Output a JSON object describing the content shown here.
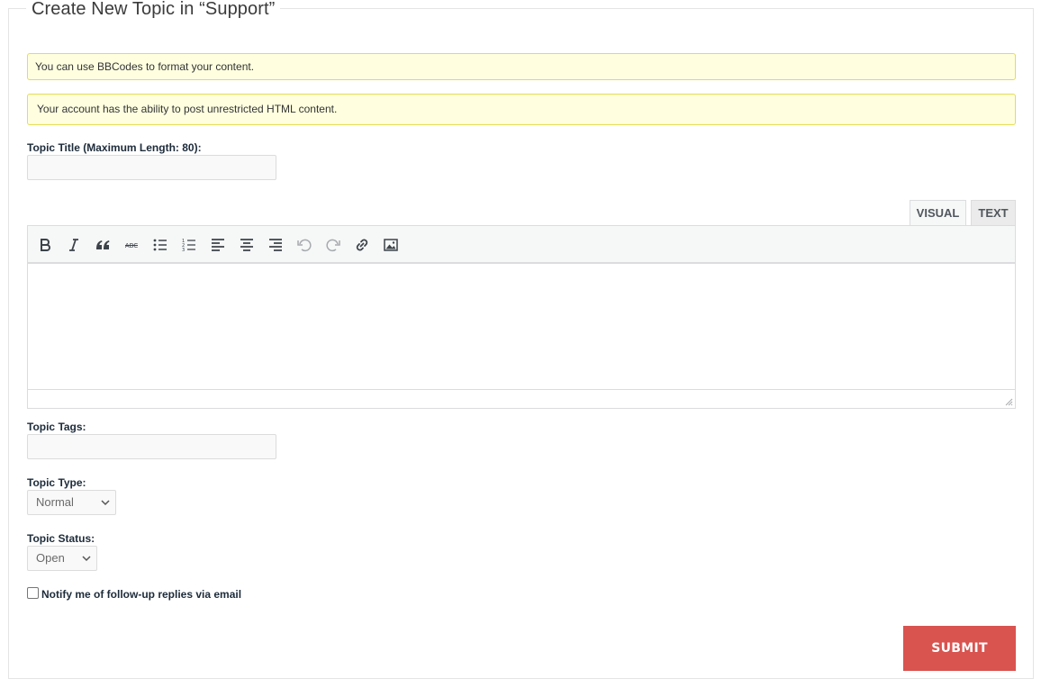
{
  "form": {
    "legend": "Create New Topic in “Support”",
    "notices": [
      "You can use BBCodes to format your content.",
      "Your account has the ability to post unrestricted HTML content."
    ],
    "title_label": "Topic Title (Maximum Length: 80):",
    "title_value": "",
    "editor": {
      "tabs": {
        "visual": "VISUAL",
        "text": "TEXT"
      },
      "active_tab": "visual",
      "toolbar": [
        "bold-icon",
        "italic-icon",
        "blockquote-icon",
        "strikethrough-icon",
        "bulleted-list-icon",
        "numbered-list-icon",
        "align-left-icon",
        "align-center-icon",
        "align-right-icon",
        "undo-icon",
        "redo-icon",
        "link-icon",
        "image-icon"
      ],
      "content": ""
    },
    "tags_label": "Topic Tags:",
    "tags_value": "",
    "type_label": "Topic Type:",
    "type_value": "Normal",
    "status_label": "Topic Status:",
    "status_value": "Open",
    "notify_label": "Notify me of follow-up replies via email",
    "notify_checked": false,
    "submit_label": "SUBMIT"
  },
  "colors": {
    "submit_bg": "#d9534f",
    "notice_bg": "#ffffe0",
    "notice_border": "#e6db55"
  }
}
